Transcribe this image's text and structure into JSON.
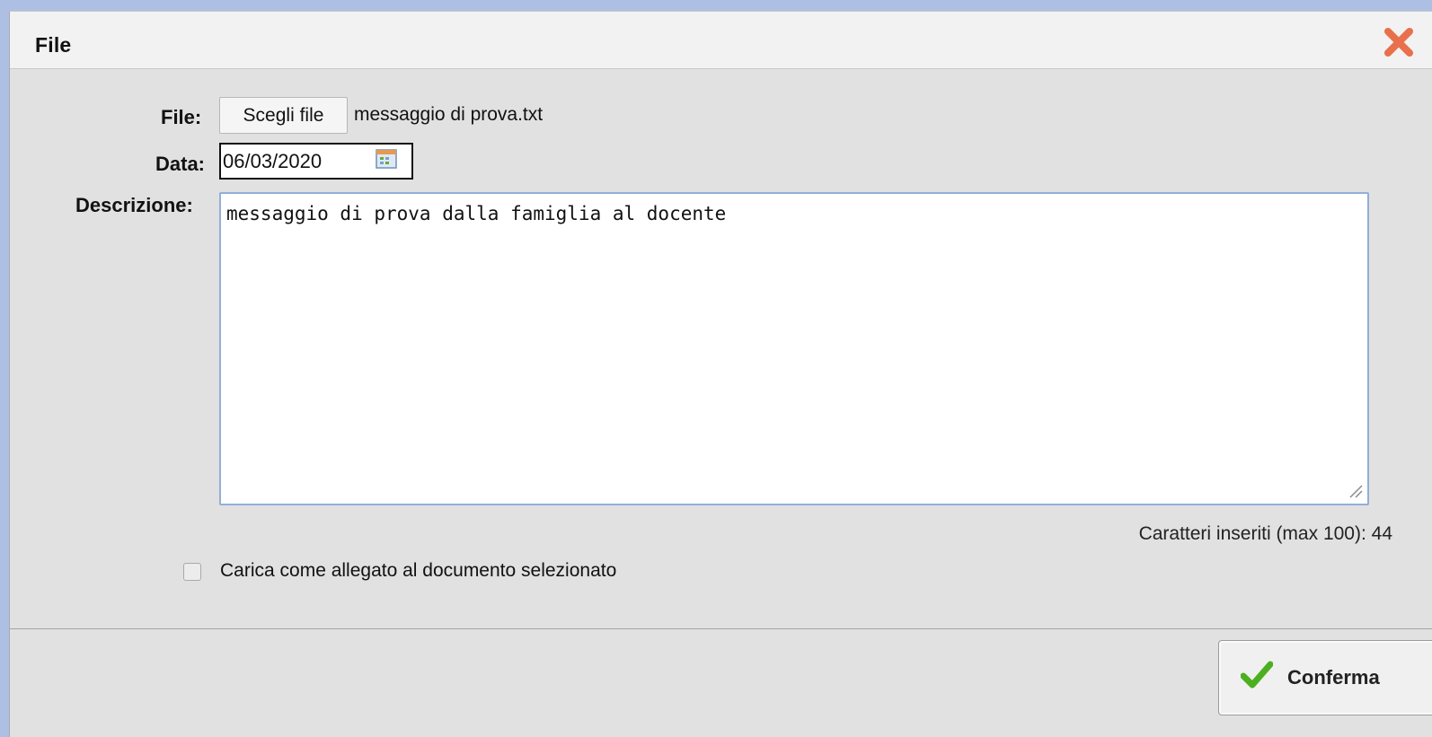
{
  "dialog": {
    "title": "File"
  },
  "form": {
    "file_label": "File:",
    "file_button": "Scegli file",
    "file_name": "messaggio di prova.txt",
    "date_label": "Data:",
    "date_value": "06/03/2020",
    "description_label": "Descrizione:",
    "description_value": "messaggio di prova dalla famiglia al docente",
    "char_counter": "Caratteri inseriti (max 100): 44",
    "attach_checkbox_label": "Carica come allegato al documento selezionato",
    "attach_checked": false
  },
  "footer": {
    "confirm_label": "Conferma"
  },
  "icons": {
    "close": "close-icon",
    "calendar": "calendar-icon",
    "confirm": "check-icon"
  },
  "colors": {
    "close": "#e8704c",
    "confirm_check": "#4caf1f",
    "textarea_border": "#93aed8"
  }
}
